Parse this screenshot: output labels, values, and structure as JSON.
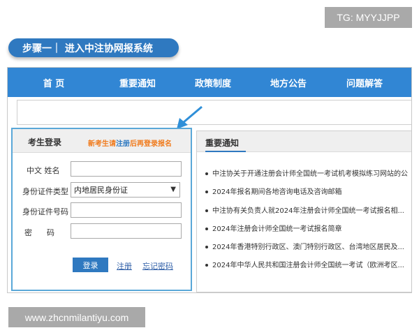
{
  "watermarks": {
    "top": "TG: MYYJJPP",
    "bottom": "www.zhcnmilantiyu.com"
  },
  "step": {
    "label": "步骤一｜ 进入中注协网报系统"
  },
  "nav": {
    "items": [
      "首 页",
      "重要通知",
      "政策制度",
      "地方公告",
      "问题解答"
    ]
  },
  "login": {
    "title": "考生登录",
    "hint_prefix": "新考生请",
    "hint_link": "注册",
    "hint_suffix": "后再登录报名",
    "fields": {
      "name_label": "中文  姓名",
      "id_type_label": "身份证件类型",
      "id_type_value": "内地居民身份证",
      "id_number_label": "身份证件号码",
      "password_label": "密      码"
    },
    "buttons": {
      "login": "登录",
      "register": "注册",
      "forgot": "忘记密码"
    }
  },
  "notice": {
    "title": "重要通知",
    "items": [
      "中注协关于开通注册会计师全国统一考试机考模拟练习网站的公",
      "2024年报名期间各地咨询电话及咨询邮箱",
      "中注协有关负责人就2024年注册会计师全国统一考试报名相...",
      "2024年注册会计师全国统一考试报名简章",
      "2024年香港特别行政区、澳门特别行政区、台湾地区居民及...",
      "2024年中华人民共和国注册会计师全国统一考试（欧洲考区..."
    ]
  },
  "colors": {
    "nav": "#3186d4",
    "accent": "#2f79c0",
    "hint": "#f07b1d",
    "highlight_border": "#5aa8d8"
  }
}
